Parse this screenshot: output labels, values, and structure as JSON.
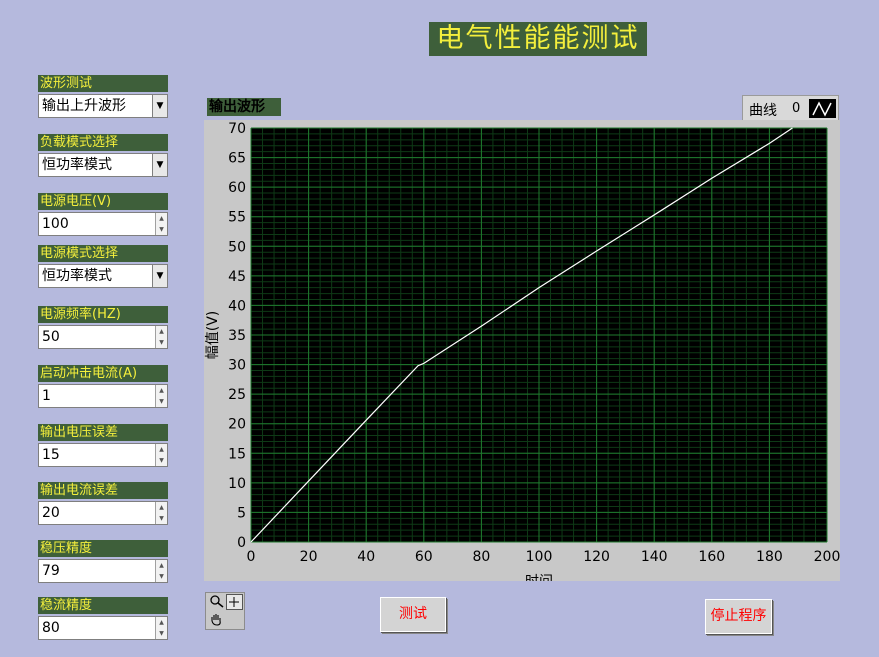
{
  "window_title": "电气性能能测试",
  "controls": [
    {
      "label": "波形测试",
      "value": "输出上升波形",
      "type": "dropdown"
    },
    {
      "label": "负载模式选择",
      "value": "恒功率模式",
      "type": "dropdown"
    },
    {
      "label": "电源电压(V)",
      "value": "100",
      "type": "numeric"
    },
    {
      "label": "电源模式选择",
      "value": "恒功率模式",
      "type": "dropdown"
    },
    {
      "label": "电源频率(HZ)",
      "value": "50",
      "type": "numeric"
    },
    {
      "label": "启动冲击电流(A)",
      "value": "1",
      "type": "numeric"
    },
    {
      "label": "输出电压误差",
      "value": "15",
      "type": "numeric"
    },
    {
      "label": "输出电流误差",
      "value": "20",
      "type": "numeric"
    },
    {
      "label": "稳压精度",
      "value": "79",
      "type": "numeric"
    },
    {
      "label": "稳流精度",
      "value": "80",
      "type": "numeric"
    }
  ],
  "graph": {
    "title": "输出波形",
    "legend_name": "曲线",
    "legend_index": "0"
  },
  "tools": {
    "zoom": "zoom-icon",
    "crosshair": "crosshair-icon",
    "pan": "hand-icon"
  },
  "buttons": {
    "test": "测试",
    "stop": "停止程序"
  },
  "colors": {
    "background": "#b5b9dd",
    "label_bg": "#3e5f3a",
    "label_text": "#f4ef3c",
    "plot_bg": "#000000",
    "grid": "#1f7a2e",
    "trace": "#ffffff",
    "button_text": "#ff0000"
  },
  "chart_data": {
    "type": "line",
    "title": "",
    "xlabel": "时间",
    "ylabel": "幅值(V)",
    "xlim": [
      0,
      200
    ],
    "ylim": [
      0,
      70
    ],
    "x_ticks": [
      0,
      20,
      40,
      60,
      80,
      100,
      120,
      140,
      160,
      180,
      200
    ],
    "y_ticks": [
      0,
      5,
      10,
      15,
      20,
      25,
      30,
      35,
      40,
      45,
      50,
      55,
      60,
      65,
      70
    ],
    "grid": true,
    "series": [
      {
        "name": "曲线 0",
        "x": [
          0,
          20,
          40,
          58,
          60,
          80,
          100,
          120,
          140,
          160,
          180,
          188
        ],
        "y": [
          0,
          10.3,
          20.6,
          29.8,
          30.2,
          36.5,
          43,
          49.2,
          55.3,
          61.5,
          67.4,
          70
        ]
      }
    ]
  }
}
